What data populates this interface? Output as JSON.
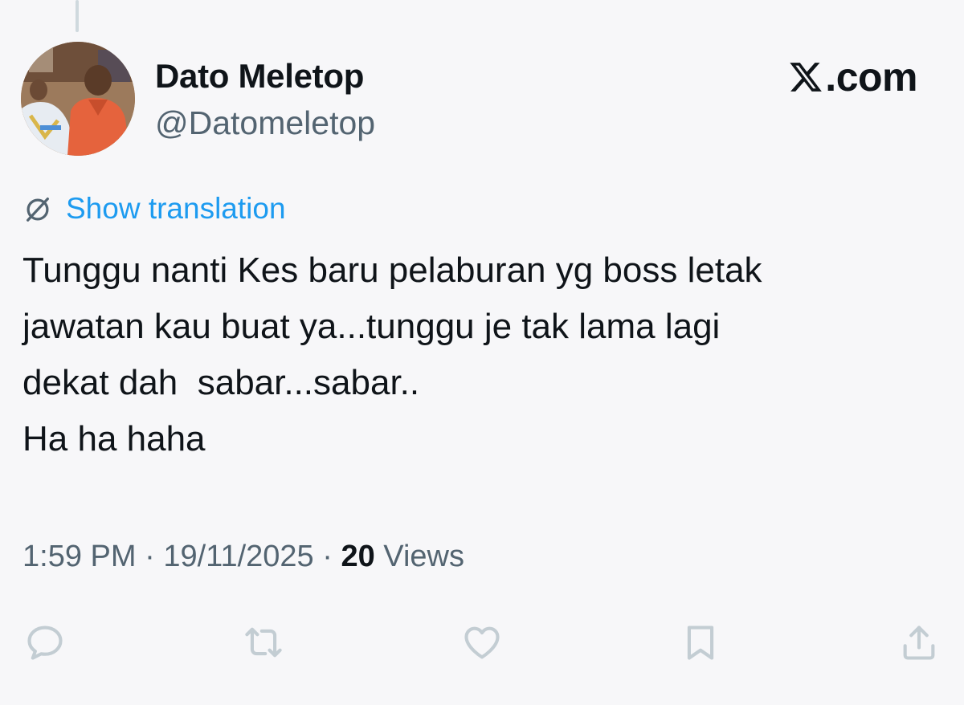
{
  "author": {
    "display_name": "Dato Meletop",
    "handle": "@Datomeletop",
    "avatar_icon": "profile-photo"
  },
  "brand": {
    "label": ".com",
    "logo_icon": "x-logo-icon"
  },
  "translate": {
    "label": "Show translation",
    "icon": "globe-slash-icon"
  },
  "tweet": {
    "lines": [
      "Tunggu nanti Kes baru pelaburan yg boss letak",
      "jawatan kau buat ya...tunggu je tak lama lagi",
      "dekat dah  sabar...sabar..",
      "Ha ha haha"
    ]
  },
  "meta": {
    "time": "1:59 PM",
    "separator": " · ",
    "date": "19/11/2025",
    "views_count": "20",
    "views_label": " Views"
  },
  "actions": [
    {
      "name": "reply",
      "icon": "reply-icon"
    },
    {
      "name": "retweet",
      "icon": "retweet-icon"
    },
    {
      "name": "like",
      "icon": "heart-icon"
    },
    {
      "name": "bookmark",
      "icon": "bookmark-icon"
    },
    {
      "name": "share",
      "icon": "share-icon"
    }
  ],
  "colors": {
    "background": "#f7f7f9",
    "text": "#0f1419",
    "secondary": "#536471",
    "link": "#1d9bf0",
    "icon": "#c3cdd3"
  }
}
